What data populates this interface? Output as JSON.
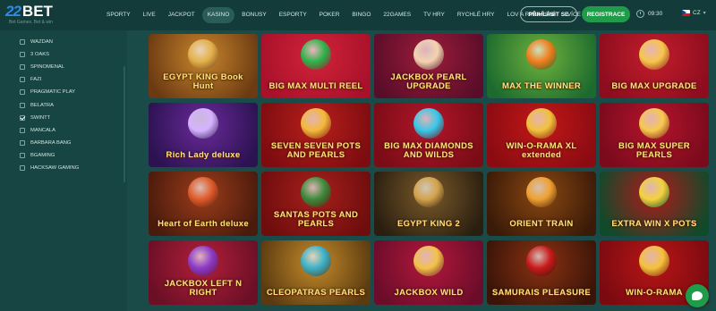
{
  "header": {
    "logo": {
      "numeral": "22",
      "brand": "BET",
      "tagline": "Bet Games. Bet & win"
    },
    "nav": [
      {
        "label": "SPORTY",
        "name": "nav-sporty",
        "active": false
      },
      {
        "label": "LIVE",
        "name": "nav-live",
        "active": false
      },
      {
        "label": "JACKPOT",
        "name": "nav-jackpot",
        "active": false
      },
      {
        "label": "KASINO",
        "name": "nav-kasino",
        "active": true
      },
      {
        "label": "BONUSY",
        "name": "nav-bonusy",
        "active": false
      },
      {
        "label": "ESPORTY",
        "name": "nav-esporty",
        "active": false
      },
      {
        "label": "POKER",
        "name": "nav-poker",
        "active": false
      },
      {
        "label": "BINGO",
        "name": "nav-bingo",
        "active": false
      },
      {
        "label": "22GAMES",
        "name": "nav-22games",
        "active": false
      },
      {
        "label": "TV HRY",
        "name": "nav-tv-hry",
        "active": false
      },
      {
        "label": "RYCHLÉ HRY",
        "name": "nav-rychle-hry",
        "active": false
      },
      {
        "label": "LOV A RYBAŘENÍ",
        "name": "nav-lov-a-rybareni",
        "active": false
      },
      {
        "label": "VÍCE",
        "name": "nav-vice",
        "active": false
      }
    ],
    "login_label": "PŘIHLÁSIT SE",
    "register_label": "REGISTRACE",
    "time": "09:30",
    "language": "CZ"
  },
  "sidebar": {
    "providers": [
      {
        "label": "WAZDAN",
        "checked": false
      },
      {
        "label": "3 OAKS",
        "checked": false
      },
      {
        "label": "SPINOMENAL",
        "checked": false
      },
      {
        "label": "FAZI",
        "checked": false
      },
      {
        "label": "PRAGMATIC PLAY",
        "checked": false
      },
      {
        "label": "BELATRA",
        "checked": false
      },
      {
        "label": "SWINTT",
        "checked": true
      },
      {
        "label": "MANCALA",
        "checked": false
      },
      {
        "label": "BARBARA BANG",
        "checked": false
      },
      {
        "label": "BGAMING",
        "checked": false
      },
      {
        "label": "HACKSAW GAMING",
        "checked": false
      }
    ]
  },
  "games": [
    {
      "title": "EGYPT KING Book Hunt",
      "bg": [
        "#6b3a12",
        "#c9862d"
      ],
      "deco": "#e3b04b"
    },
    {
      "title": "BIG MAX MULTI REEL",
      "bg": [
        "#a8112a",
        "#d1233a"
      ],
      "deco": "#2db34a"
    },
    {
      "title": "JACKBOX PEARL UPGRADE",
      "bg": [
        "#5a0d2a",
        "#9c1c3a"
      ],
      "deco": "#f3d3b0"
    },
    {
      "title": "MAX THE WINNER",
      "bg": [
        "#1c6a2e",
        "#6fb23d"
      ],
      "deco": "#f07d1b"
    },
    {
      "title": "BIG MAX UPGRADE",
      "bg": [
        "#8c0d1e",
        "#c41d2c"
      ],
      "deco": "#f6c64a"
    },
    {
      "title": "Rich Lady deluxe",
      "bg": [
        "#2b1250",
        "#6a2a9a"
      ],
      "deco": "#d5b3ff"
    },
    {
      "title": "SEVEN SEVEN POTS AND PEARLS",
      "bg": [
        "#7d0c10",
        "#b81f1c"
      ],
      "deco": "#f2b93a"
    },
    {
      "title": "BIG MAX DIAMONDS AND WILDS",
      "bg": [
        "#7a0c16",
        "#b3162b"
      ],
      "deco": "#38c8e8"
    },
    {
      "title": "WIN-O-RAMA XL extended",
      "bg": [
        "#8a0b12",
        "#c21818"
      ],
      "deco": "#f0c23b"
    },
    {
      "title": "BIG MAX SUPER PEARLS",
      "bg": [
        "#7a0a1c",
        "#b5142c"
      ],
      "deco": "#f7c94d"
    },
    {
      "title": "Heart of Earth deluxe",
      "bg": [
        "#4a1a0c",
        "#9b3d1a"
      ],
      "deco": "#e05a2a"
    },
    {
      "title": "SANTAS POTS AND PEARLS",
      "bg": [
        "#6e0d0d",
        "#a6201c"
      ],
      "deco": "#3a8a3a"
    },
    {
      "title": "EGYPT KING 2",
      "bg": [
        "#2a1e10",
        "#7a5a2a"
      ],
      "deco": "#d3a24b"
    },
    {
      "title": "ORIENT TRAIN",
      "bg": [
        "#3a1a08",
        "#8a4812"
      ],
      "deco": "#f0a030"
    },
    {
      "title": "EXTRA WIN X POTS",
      "bg": [
        "#0f4a2a",
        "#b01a1a"
      ],
      "deco": "#f4d23c"
    },
    {
      "title": "JACKBOX LEFT N RIGHT",
      "bg": [
        "#6a0f26",
        "#b21f3a"
      ],
      "deco": "#8a3ac8"
    },
    {
      "title": "CLEOPATRAS PEARLS",
      "bg": [
        "#5a3a10",
        "#c48a2a"
      ],
      "deco": "#3ab0c8"
    },
    {
      "title": "JACKBOX WILD",
      "bg": [
        "#6a0c2a",
        "#b2183a"
      ],
      "deco": "#f2c24a"
    },
    {
      "title": "SAMURAIS PLEASURE",
      "bg": [
        "#3a1408",
        "#8a3212"
      ],
      "deco": "#c81a1a"
    },
    {
      "title": "WIN-O-RAMA",
      "bg": [
        "#7a0a10",
        "#b81616"
      ],
      "deco": "#f4c23a"
    }
  ]
}
